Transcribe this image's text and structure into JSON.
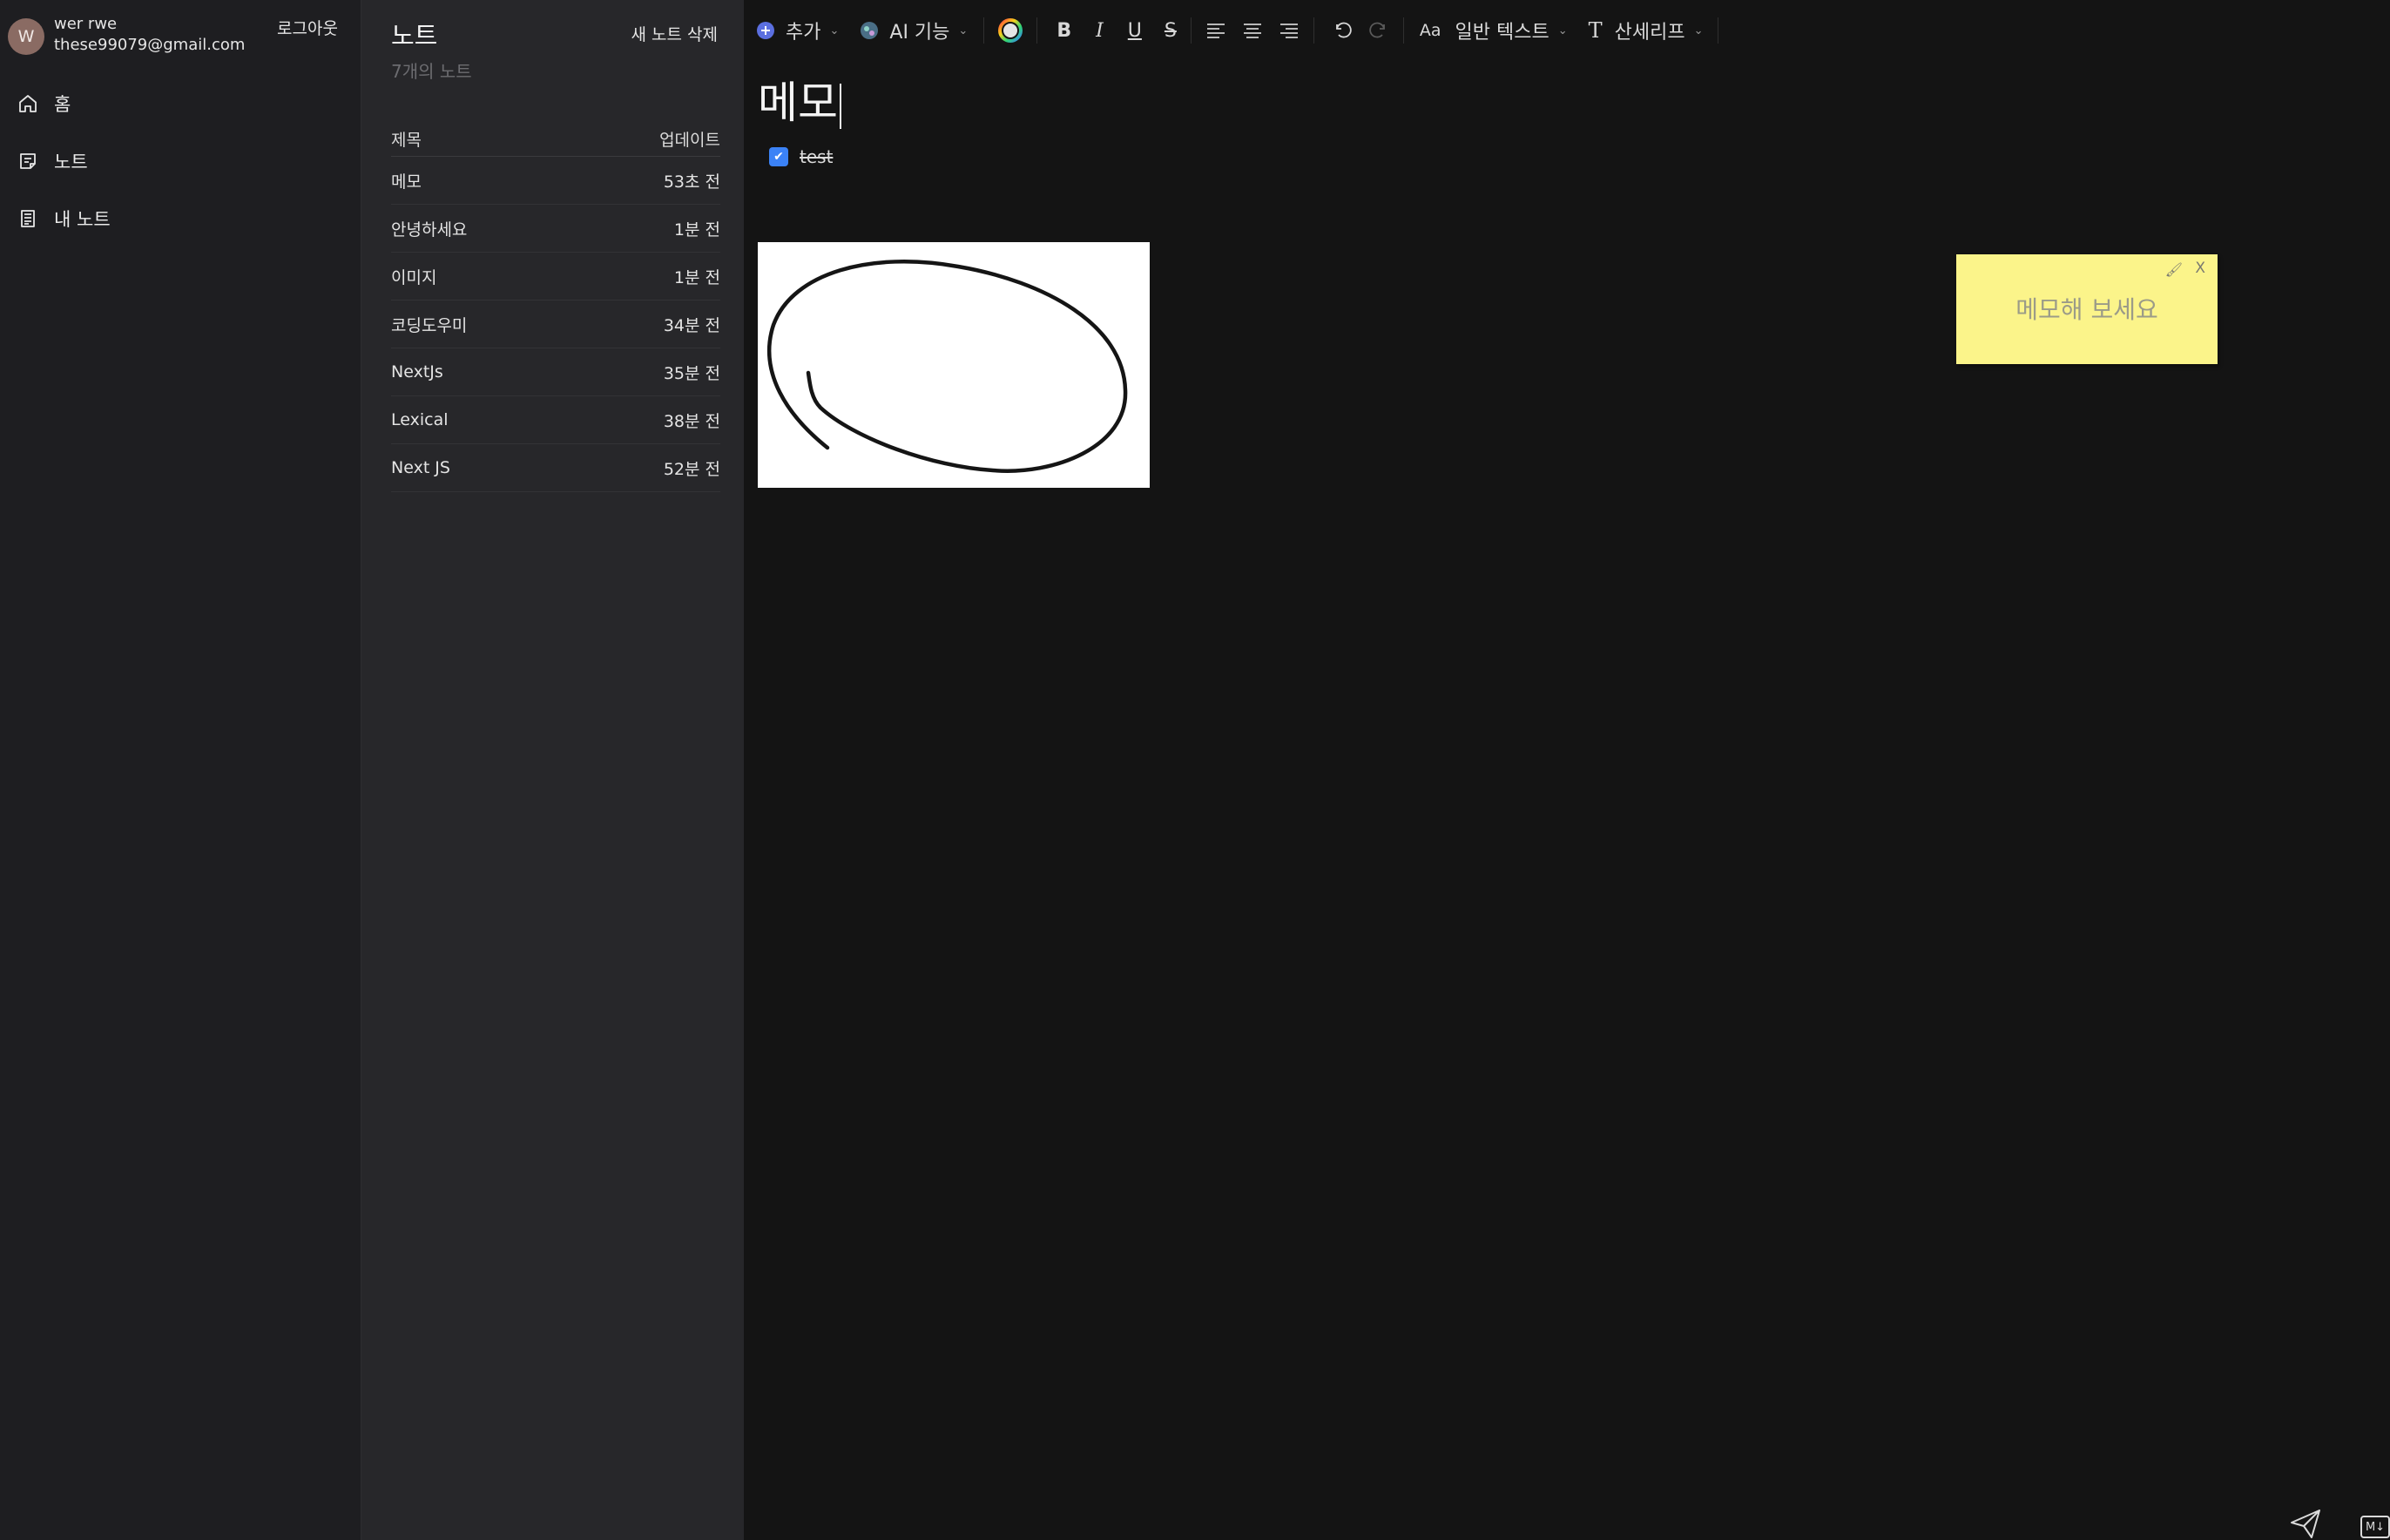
{
  "user": {
    "avatar_initial": "W",
    "name": "wer rwe",
    "email": "these99079@gmail.com",
    "logout_label": "로그아웃"
  },
  "sidebar": {
    "items": [
      {
        "label": "홈",
        "icon": "home-icon"
      },
      {
        "label": "노트",
        "icon": "note-icon"
      },
      {
        "label": "내 노트",
        "icon": "my-notes-icon"
      }
    ]
  },
  "list": {
    "title": "노트",
    "count_text": "7개의 노트",
    "new_label": "새 노트",
    "delete_label": "삭제",
    "col_title": "제목",
    "col_updated": "업데이트",
    "notes": [
      {
        "title": "메모",
        "updated": "53초 전"
      },
      {
        "title": "안녕하세요",
        "updated": "1분 전"
      },
      {
        "title": "이미지",
        "updated": "1분 전"
      },
      {
        "title": "코딩도우미",
        "updated": "34분 전"
      },
      {
        "title": "NextJs",
        "updated": "35분 전"
      },
      {
        "title": "Lexical",
        "updated": "38분 전"
      },
      {
        "title": "Next JS",
        "updated": "52분 전"
      }
    ]
  },
  "toolbar": {
    "add_label": "추가",
    "ai_label": "AI 기능",
    "bold": "B",
    "italic": "I",
    "underline": "U",
    "strike": "S",
    "font_size_icon": "Aa",
    "block_type": "일반 텍스트",
    "font_icon": "T",
    "font_family": "산세리프"
  },
  "editor": {
    "title": "메모",
    "checklist": [
      {
        "text": "test",
        "checked": true
      }
    ]
  },
  "sticky": {
    "placeholder": "메모해 보세요",
    "close": "X",
    "color": "#fbf48a"
  },
  "footer": {
    "markdown_label": "M↓"
  },
  "colors": {
    "accent": "#3b82f6",
    "sidebar_bg": "#1e1e21",
    "list_bg": "#27272a",
    "editor_bg": "#141414"
  }
}
